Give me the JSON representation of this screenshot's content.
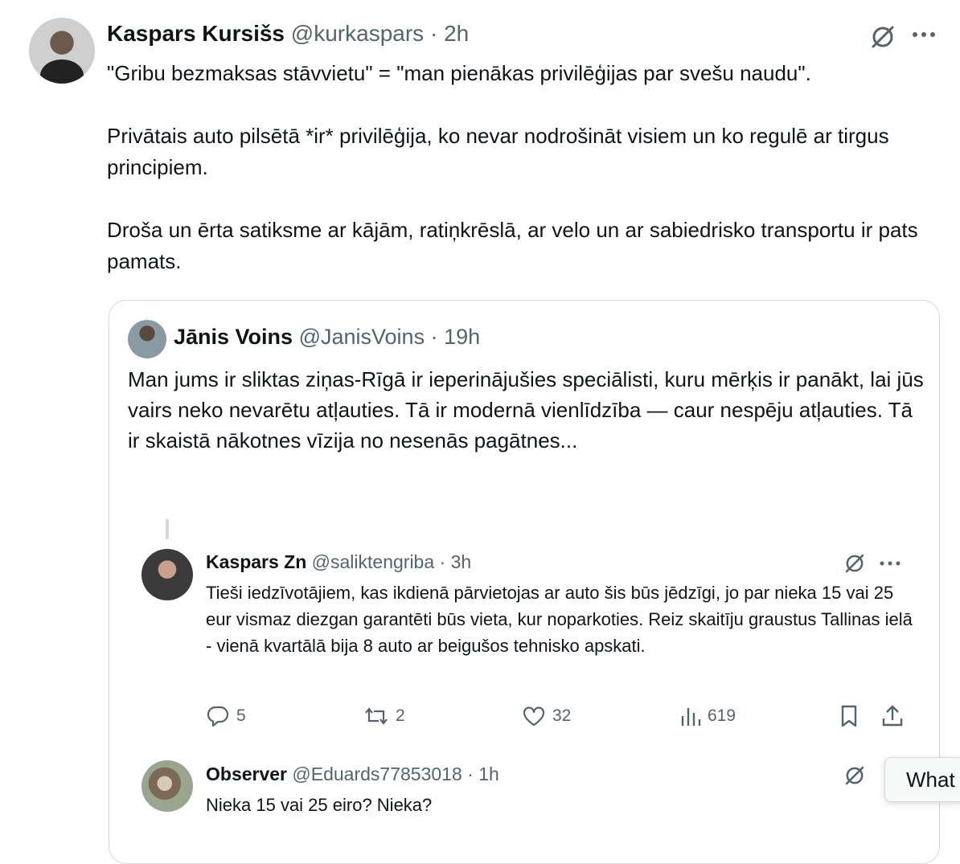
{
  "main_tweet": {
    "author_name": "Kaspars Kursišs",
    "handle": "@kurkaspars",
    "separator": "·",
    "time": "2h",
    "paragraphs": [
      "\"Gribu bezmaksas stāvvietu\" = \"man pienākas privilēģijas par svešu naudu\".",
      "Privātais auto pilsētā *ir* privilēģija, ko nevar nodrošināt visiem un ko regulē ar tirgus principiem.",
      "Droša un ērta satiksme ar kājām, ratiņkrēslā, ar velo un ar sabiedrisko transportu ir pats pamats."
    ]
  },
  "quoted_tweet": {
    "author_name": "Jānis Voins",
    "handle": "@JanisVoins",
    "separator": "·",
    "time": "19h",
    "text": "Man jums ir sliktas ziņas-Rīgā ir ieperinājušies speciālisti, kuru mērķis ir panākt, lai jūs vairs neko nevarētu atļauties. Tā ir modernā vienlīdzība — caur nespēju atļauties. Tā ir skaistā nākotnes vīzija no nesenās pagātnes..."
  },
  "embedded_replies": [
    {
      "author_name": "Kaspars Zn",
      "handle": "@saliktengriba",
      "separator": "·",
      "time": "3h",
      "text": "Tieši iedzīvotājiem, kas ikdienā pārvietojas ar auto šis būs jēdzīgi, jo par nieka 15 vai 25 eur vismaz diezgan garantēti būs vieta, kur noparkoties. Reiz skaitīju graustus Tallinas ielā - vienā kvartālā bija 8 auto ar beigušos tehnisko apskati.",
      "replies": "5",
      "reposts": "2",
      "likes": "32",
      "views": "619"
    },
    {
      "author_name": "Observer",
      "handle": "@Eduards77853018",
      "separator": "·",
      "time": "1h",
      "text": "Nieka 15 vai 25 eiro? Nieka?"
    }
  ],
  "tooltip": {
    "text": "What"
  },
  "icons": {
    "grok": "grok-slash-icon",
    "more": "more-dots-icon",
    "reply": "reply-bubble-icon",
    "repost": "repost-icon",
    "like": "heart-icon",
    "views": "views-bar-icon",
    "bookmark": "bookmark-icon",
    "share": "share-icon"
  },
  "colors": {
    "text": "#0f1419",
    "muted": "#536471",
    "border": "#cfd9de"
  }
}
